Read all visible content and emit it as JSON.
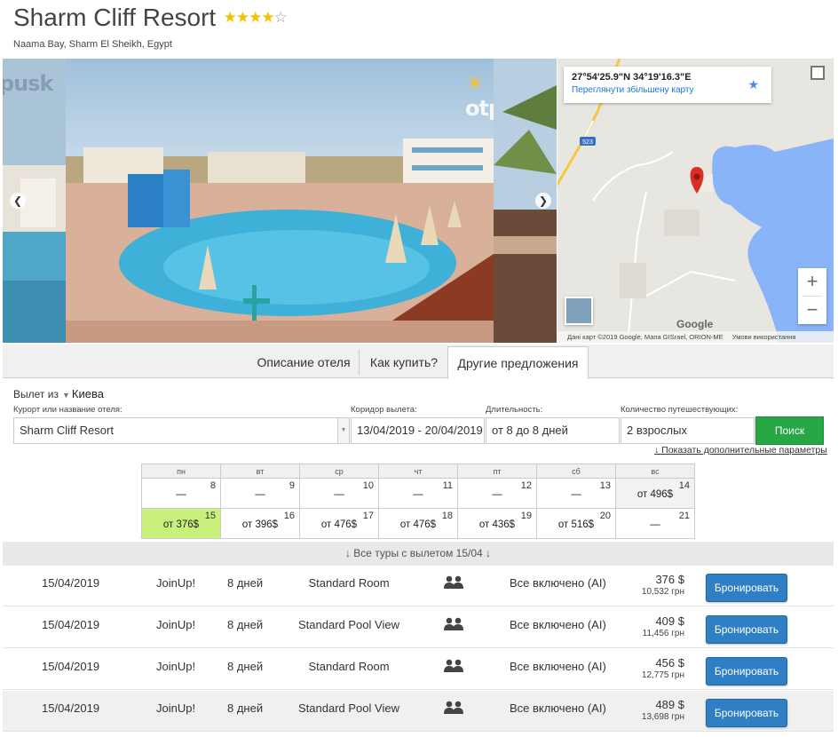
{
  "hotel": {
    "name": "Sharm Cliff Resort",
    "stars": 4,
    "max_stars": 5,
    "location": "Naama Bay, Sharm El Sheikh, Egypt"
  },
  "gallery": {
    "watermark": "otpusk"
  },
  "map": {
    "coordinates": "27°54'25.9\"N 34°19'16.3\"E",
    "view_larger": "Переглянути збільшену карту",
    "google": "Google",
    "attribution": "Дані карт ©2019 Google, Мапа GISrael, ORION-ME",
    "terms": "Умови використання",
    "road_label": "523"
  },
  "tabs": [
    {
      "label": "Описание отеля",
      "active": false
    },
    {
      "label": "Как купить?",
      "active": false
    },
    {
      "label": "Другие предложения",
      "active": true
    }
  ],
  "search": {
    "depart_label": "Вылет из",
    "depart_city": "Киева",
    "resort_label": "Курорт или название отеля:",
    "resort_value": "Sharm Cliff Resort",
    "dates_label": "Коридор вылета:",
    "dates_value": "13/04/2019 - 20/04/2019",
    "duration_label": "Длительность:",
    "duration_value": "от 8 до 8 дней",
    "travelers_label": "Количество путешествующих:",
    "travelers_value": "2 взрослых",
    "search_button": "Поиск",
    "more_params": "↓ Показать дополнительные параметры"
  },
  "calendar": {
    "weekdays": [
      "пн",
      "вт",
      "ср",
      "чт",
      "пт",
      "сб",
      "вс"
    ],
    "weeks": [
      [
        {
          "day": "8",
          "price": "—"
        },
        {
          "day": "9",
          "price": "—"
        },
        {
          "day": "10",
          "price": "—"
        },
        {
          "day": "11",
          "price": "—"
        },
        {
          "day": "12",
          "price": "—"
        },
        {
          "day": "13",
          "price": "—"
        },
        {
          "day": "14",
          "price": "от 496$"
        }
      ],
      [
        {
          "day": "15",
          "price": "от 376$"
        },
        {
          "day": "16",
          "price": "от 396$"
        },
        {
          "day": "17",
          "price": "от 476$"
        },
        {
          "day": "18",
          "price": "от 476$"
        },
        {
          "day": "19",
          "price": "от 436$"
        },
        {
          "day": "20",
          "price": "от 516$"
        },
        {
          "day": "21",
          "price": "—"
        }
      ]
    ]
  },
  "results": {
    "header": "↓ Все туры с вылетом 15/04 ↓",
    "book_label": "Бронировать",
    "rows": [
      {
        "date": "15/04/2019",
        "operator": "JoinUp!",
        "duration": "8 дней",
        "room": "Standard Room",
        "meal": "Все включено (AI)",
        "price_usd": "376 $",
        "price_uah": "10,532 грн"
      },
      {
        "date": "15/04/2019",
        "operator": "JoinUp!",
        "duration": "8 дней",
        "room": "Standard Pool View",
        "meal": "Все включено (AI)",
        "price_usd": "409 $",
        "price_uah": "11,456 грн"
      },
      {
        "date": "15/04/2019",
        "operator": "JoinUp!",
        "duration": "8 дней",
        "room": "Standard Room",
        "meal": "Все включено (AI)",
        "price_usd": "456 $",
        "price_uah": "12,775 грн"
      },
      {
        "date": "15/04/2019",
        "operator": "JoinUp!",
        "duration": "8 дней",
        "room": "Standard Pool View",
        "meal": "Все включено (AI)",
        "price_usd": "489 $",
        "price_uah": "13,698 грн"
      }
    ]
  }
}
